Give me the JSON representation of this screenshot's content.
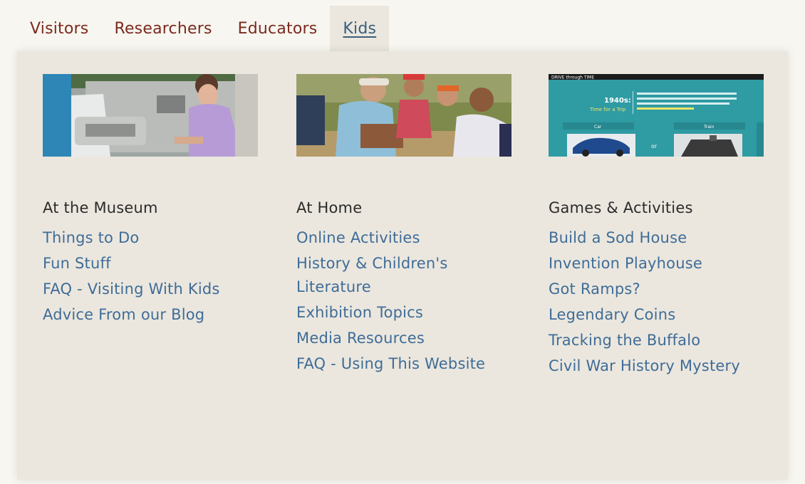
{
  "nav": {
    "items": [
      {
        "label": "Visitors"
      },
      {
        "label": "Researchers"
      },
      {
        "label": "Educators"
      },
      {
        "label": "Kids"
      }
    ],
    "active": "Kids"
  },
  "columns": [
    {
      "heading": "At the Museum",
      "image": "museum-kids-activity-photo",
      "links": [
        "Things to Do",
        "Fun Stuff",
        "FAQ - Visiting With Kids",
        "Advice From our Blog"
      ]
    },
    {
      "heading": "At Home",
      "image": "kids-group-reading-photo",
      "links": [
        "Online Activities",
        "History & Children's Literature",
        "Exhibition Topics",
        "Media Resources",
        "FAQ - Using This Website"
      ]
    },
    {
      "heading": "Games & Activities",
      "image": "drive-through-time-game-screenshot",
      "game_screen": {
        "title": "DRIVE through TIME",
        "era": "1940s:",
        "subtitle": "Time for a Trip",
        "choice_left": "Car",
        "choice_right": "Train",
        "or": "or"
      },
      "links": [
        "Build a Sod House",
        "Invention Playhouse",
        "Got Ramps?",
        "Legendary Coins",
        "Tracking the Buffalo",
        "Civil War History Mystery"
      ]
    }
  ],
  "colors": {
    "nav_text": "#7a2a1f",
    "link": "#3f6c98",
    "panel_bg": "#ebe7de"
  }
}
